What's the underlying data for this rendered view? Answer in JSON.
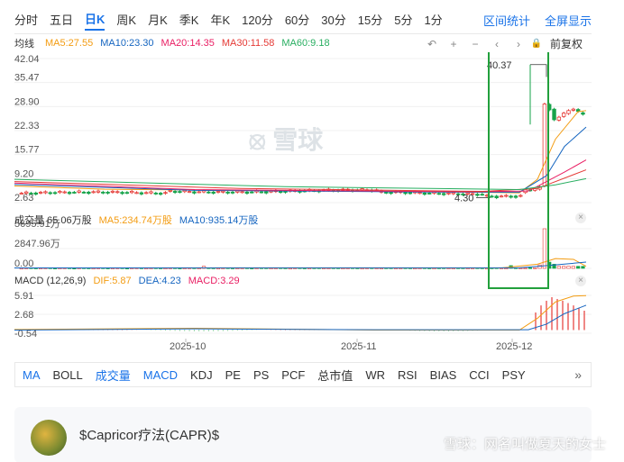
{
  "tabs": [
    "分时",
    "五日",
    "日K",
    "周K",
    "月K",
    "季K",
    "年K",
    "120分",
    "60分",
    "30分",
    "15分",
    "5分",
    "1分"
  ],
  "tabs_right": [
    "区间统计",
    "全屏显示"
  ],
  "ma": {
    "label": "均线",
    "items": [
      {
        "text": "MA5:27.55",
        "color": "#f39c12"
      },
      {
        "text": "MA10:23.30",
        "color": "#1565c0"
      },
      {
        "text": "MA20:14.35",
        "color": "#e91e63"
      },
      {
        "text": "MA30:11.58",
        "color": "#e53935"
      },
      {
        "text": "MA60:9.18",
        "color": "#27ae60"
      }
    ]
  },
  "controls": {
    "restore": "↶",
    "plus": "+",
    "minus": "−",
    "prev": "‹",
    "next": "›",
    "lock": "🔒",
    "adjust": "前复权"
  },
  "main_axis": [
    "42.04",
    "35.47",
    "28.90",
    "22.33",
    "15.77",
    "9.20",
    "2.63"
  ],
  "annotations": {
    "high": "40.37",
    "low": "4.30"
  },
  "volume": {
    "label": "成交量 65.06万股",
    "ma5": "MA5:234.74万股",
    "ma10": "MA10:935.14万股",
    "axis": [
      "5695.91万",
      "2847.96万",
      "0.00"
    ]
  },
  "macd": {
    "label": "MACD (12,26,9)",
    "dif": "DIF:5.87",
    "dea": "DEA:4.23",
    "macd": "MACD:3.29",
    "axis": [
      "5.91",
      "2.68",
      "-0.54"
    ]
  },
  "x_axis": [
    "2025-10",
    "2025-11",
    "2025-12"
  ],
  "indicators": [
    "MA",
    "BOLL",
    "成交量",
    "MACD",
    "KDJ",
    "PE",
    "PS",
    "PCF",
    "总市值",
    "WR",
    "RSI",
    "BIAS",
    "CCI",
    "PSY"
  ],
  "indicators_active": [
    "MA",
    "成交量",
    "MACD"
  ],
  "more": "»",
  "logo_text": "雪球",
  "post": {
    "title": "$Capricor疗法(CAPR)$"
  },
  "watermark": "雪球：网名叫做夏天的女士",
  "colors": {
    "up": "#e53935",
    "down": "#16a34a",
    "highlight": "#22a03c"
  }
}
